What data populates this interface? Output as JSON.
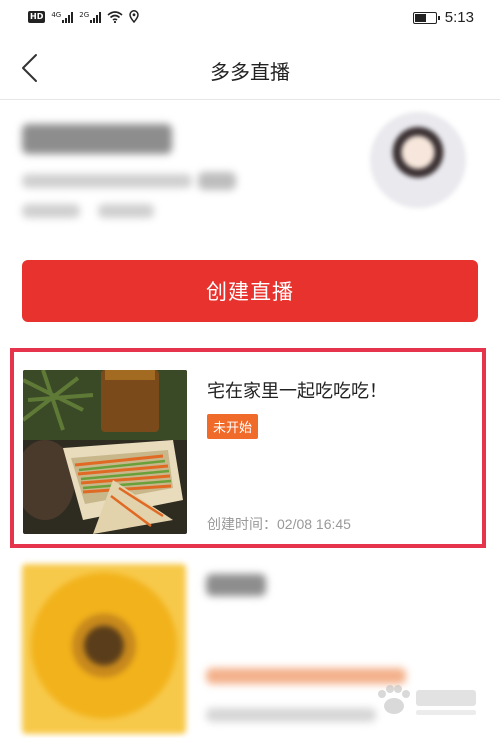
{
  "status_bar": {
    "hd_label": "HD",
    "network_1": "4G",
    "network_2": "2G",
    "time": "5:13",
    "icons": [
      "hd-icon",
      "signal-icon",
      "wifi-icon",
      "location-icon",
      "battery-icon"
    ]
  },
  "nav": {
    "title": "多多直播",
    "back_icon": "chevron-left-icon"
  },
  "actions": {
    "create_label": "创建直播"
  },
  "live_card": {
    "title": "宅在家里一起吃吃吃！",
    "status": "未开始",
    "created_time": "创建时间：02/08 16:45"
  },
  "colors": {
    "primary_red": "#e8322e",
    "highlight_border": "#e5344b",
    "badge_orange": "#f06a2a",
    "muted_text": "#999999"
  }
}
